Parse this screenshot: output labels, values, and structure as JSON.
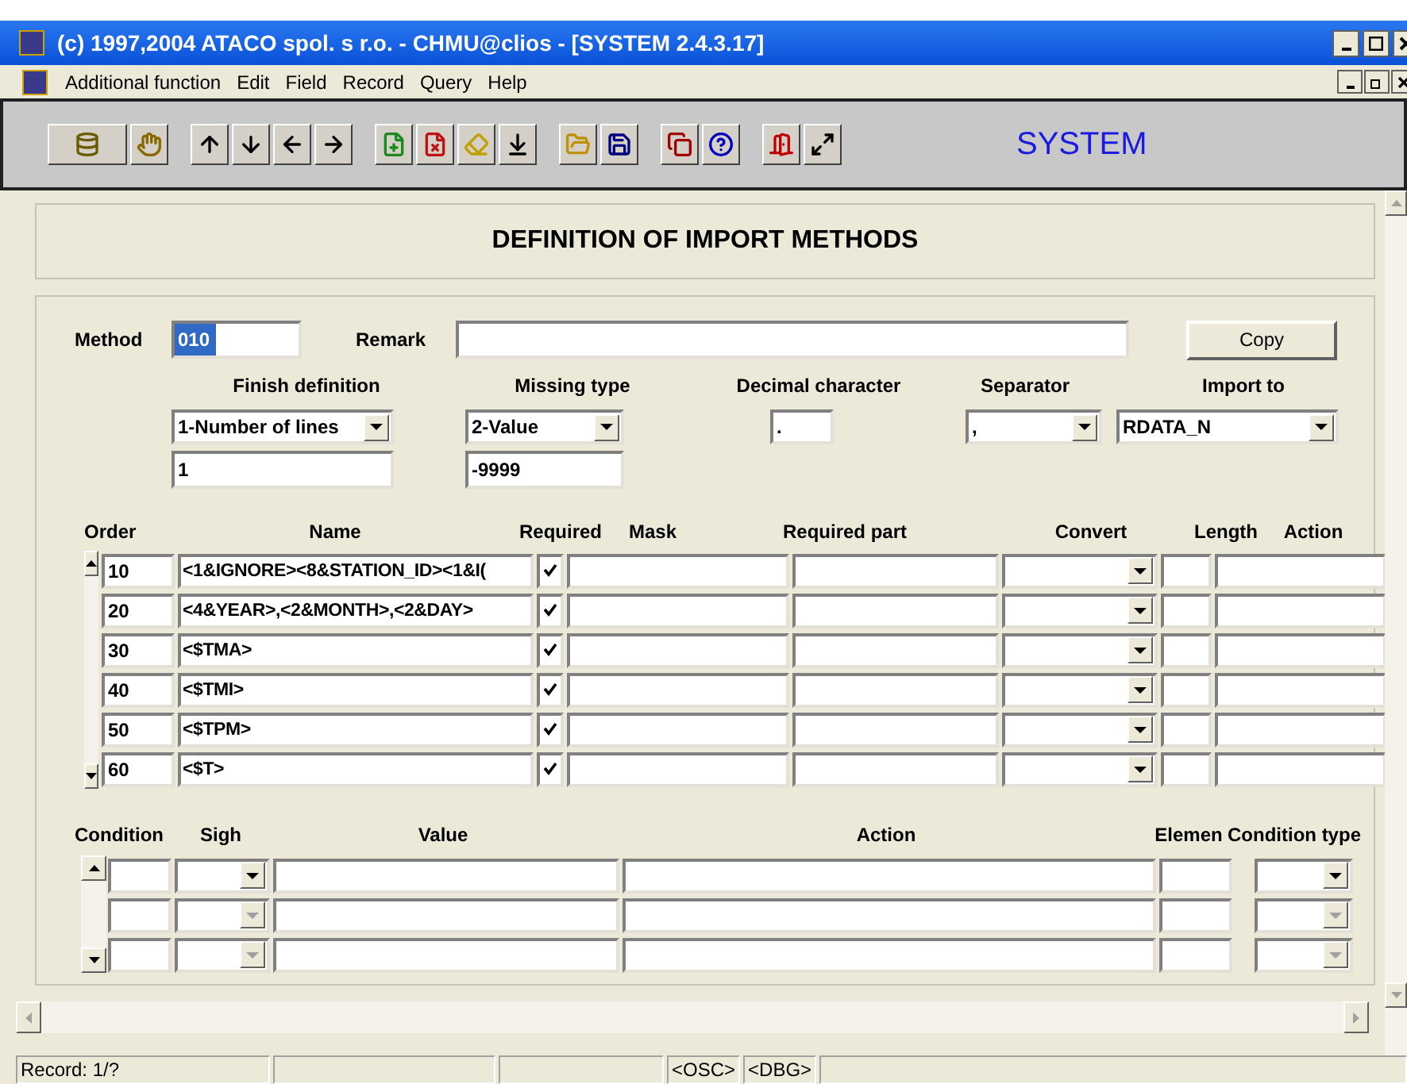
{
  "window": {
    "title": "(c) 1997,2004 ATACO spol. s r.o. - CHMU@clios - [SYSTEM 2.4.3.17]"
  },
  "menu": [
    "Additional function",
    "Edit",
    "Field",
    "Record",
    "Query",
    "Help"
  ],
  "toolbar": {
    "module": "SYSTEM"
  },
  "header": "DEFINITION OF IMPORT METHODS",
  "method": {
    "label": "Method",
    "value": "010",
    "highlighted": true
  },
  "remark": {
    "label": "Remark"
  },
  "copy_button": "Copy",
  "settings": [
    {
      "label": "Finish definition",
      "kind": "dropdown",
      "value": "1-Number of lines",
      "extra": "1"
    },
    {
      "label": "Missing type",
      "kind": "dropdown",
      "value": "2-Value",
      "extra": "-9999"
    },
    {
      "label": "Decimal character",
      "kind": "field",
      "value": "."
    },
    {
      "label": "Separator",
      "kind": "dropdown",
      "value": ","
    },
    {
      "label": "Import to",
      "kind": "dropdown",
      "value": "RDATA_N"
    }
  ],
  "table": {
    "columns": [
      "Order",
      "Name",
      "Required",
      "Mask",
      "Required part",
      "Convert",
      "Length",
      "Action"
    ],
    "rows": [
      {
        "order": "10",
        "name": "<1&IGNORE><8&STATION_ID><1&I(",
        "required": true
      },
      {
        "order": "20",
        "name": "<4&YEAR>,<2&MONTH>,<2&DAY>",
        "required": true
      },
      {
        "order": "30",
        "name": "<$TMA>",
        "required": true
      },
      {
        "order": "40",
        "name": "<$TMI>",
        "required": true
      },
      {
        "order": "50",
        "name": "<$TPM>",
        "required": true
      },
      {
        "order": "60",
        "name": "<$T>",
        "required": true
      }
    ]
  },
  "conditions": {
    "columns": [
      "Condition",
      "Sigh",
      "Value",
      "Action",
      "Elemen",
      "Condition type"
    ],
    "rows": [
      {
        "disabled": false
      },
      {
        "disabled": true
      },
      {
        "disabled": true
      }
    ]
  },
  "status_bar": {
    "record": "Record: 1/?",
    "flags": [
      "<OSC>",
      "<DBG>"
    ]
  }
}
